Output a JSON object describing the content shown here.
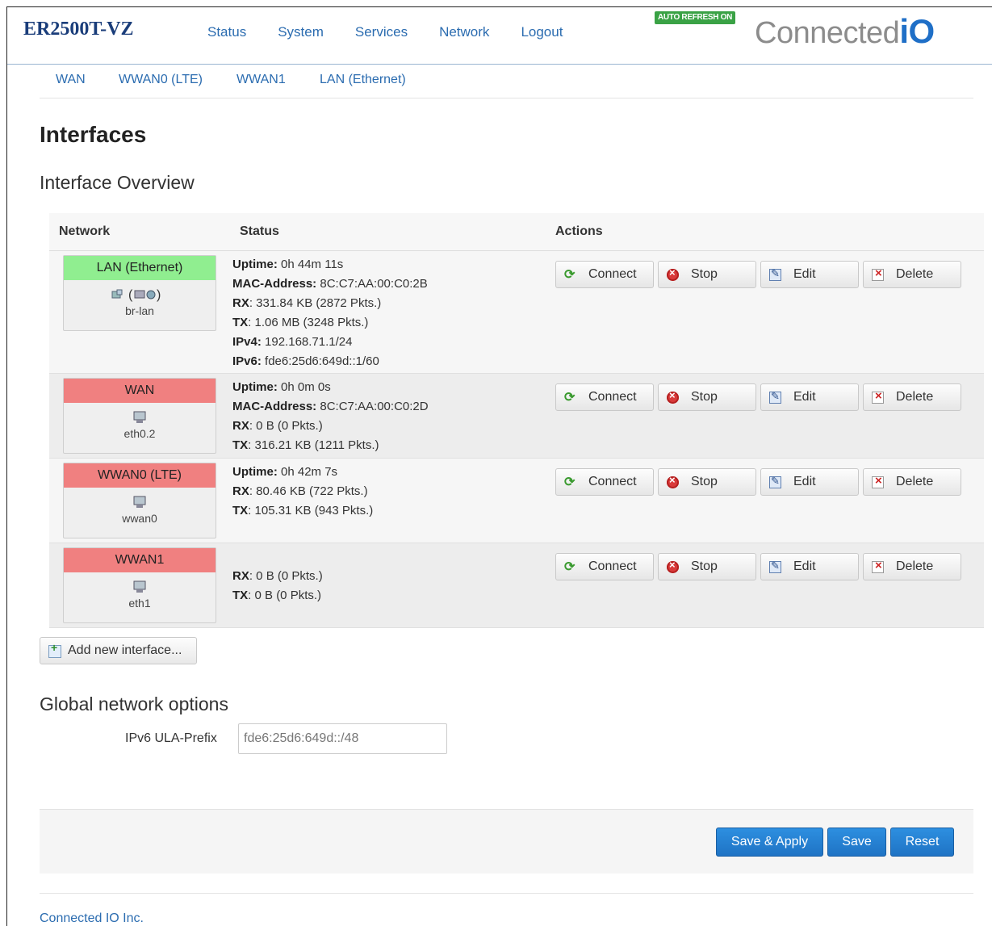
{
  "header": {
    "brand": "ER2500T-VZ",
    "nav": [
      "Status",
      "System",
      "Services",
      "Network",
      "Logout"
    ],
    "auto_refresh": "AUTO REFRESH ON",
    "logo_text": "Connected",
    "logo_io": "iO"
  },
  "subnav": [
    "WAN",
    "WWAN0 (LTE)",
    "WWAN1",
    "LAN (Ethernet)"
  ],
  "page_title": "Interfaces",
  "section_title": "Interface Overview",
  "table": {
    "headers": {
      "network": "Network",
      "status": "Status",
      "actions": "Actions"
    },
    "rows": [
      {
        "name": "LAN (Ethernet)",
        "state": "green",
        "icons": "bridge-icons",
        "device": "br-lan",
        "lines": [
          {
            "k": "Uptime:",
            "v": " 0h 44m 11s"
          },
          {
            "k": "MAC-Address:",
            "v": " 8C:C7:AA:00:C0:2B"
          },
          {
            "k": "RX",
            "v": ": 331.84 KB (2872 Pkts.)"
          },
          {
            "k": "TX",
            "v": ": 1.06 MB (3248 Pkts.)"
          },
          {
            "k": "IPv4:",
            "v": " 192.168.71.1/24"
          },
          {
            "k": "IPv6:",
            "v": " fde6:25d6:649d::1/60"
          }
        ]
      },
      {
        "name": "WAN",
        "state": "red",
        "icons": "ethernet-icon",
        "device": "eth0.2",
        "lines": [
          {
            "k": "Uptime:",
            "v": " 0h 0m 0s"
          },
          {
            "k": "MAC-Address:",
            "v": " 8C:C7:AA:00:C0:2D"
          },
          {
            "k": "RX",
            "v": ": 0 B (0 Pkts.)"
          },
          {
            "k": "TX",
            "v": ": 316.21 KB (1211 Pkts.)"
          }
        ]
      },
      {
        "name": "WWAN0 (LTE)",
        "state": "red",
        "icons": "ethernet-icon",
        "device": "wwan0",
        "lines": [
          {
            "k": "Uptime:",
            "v": " 0h 42m 7s"
          },
          {
            "k": "RX",
            "v": ": 80.46 KB (722 Pkts.)"
          },
          {
            "k": "TX",
            "v": ": 105.31 KB (943 Pkts.)"
          }
        ]
      },
      {
        "name": "WWAN1",
        "state": "red",
        "icons": "ethernet-icon",
        "device": "eth1",
        "lines": [
          {
            "k": "RX",
            "v": ": 0 B (0 Pkts.)"
          },
          {
            "k": "TX",
            "v": ": 0 B (0 Pkts.)"
          }
        ]
      }
    ],
    "actions": [
      "Connect",
      "Stop",
      "Edit",
      "Delete"
    ]
  },
  "add_interface": "Add new interface...",
  "global": {
    "title": "Global network options",
    "ula_label": "IPv6 ULA-Prefix",
    "ula_value": "fde6:25d6:649d::/48"
  },
  "footer": {
    "save_apply": "Save & Apply",
    "save": "Save",
    "reset": "Reset",
    "company": "Connected IO Inc."
  },
  "colors": {
    "up": "#90ee90",
    "down": "#f08080",
    "link": "#2b6cb0",
    "primary": "#1f73c4"
  }
}
